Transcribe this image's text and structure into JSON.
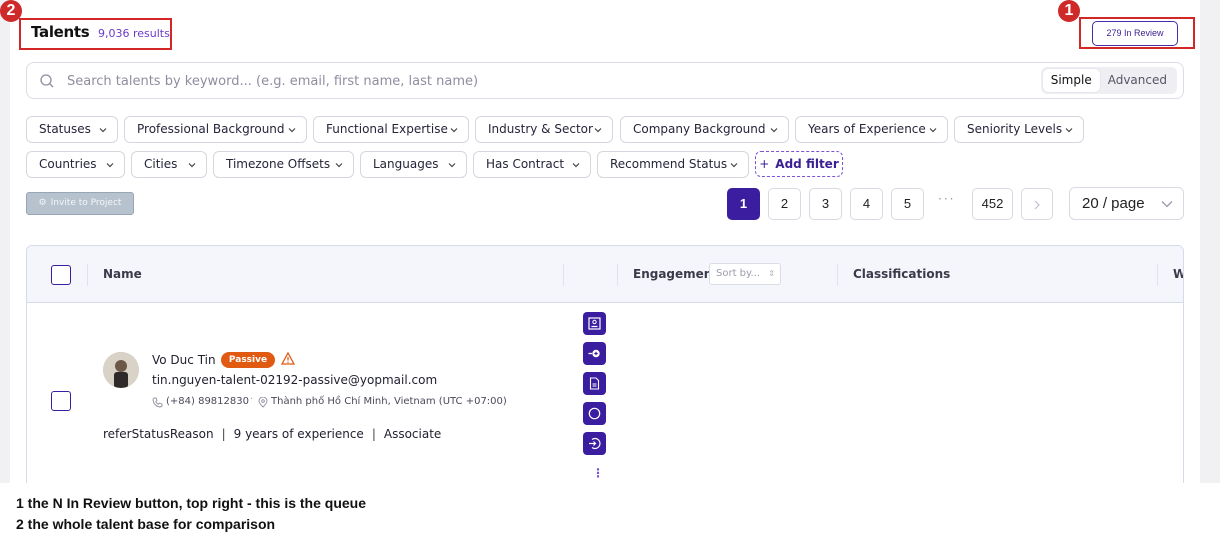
{
  "header": {
    "title": "Talents",
    "results": "9,036 results",
    "review_button": "279  In Review"
  },
  "search": {
    "placeholder": "Search talents by keyword... (e.g. email, first name, last name)",
    "modes": [
      "Simple",
      "Advanced"
    ],
    "active_mode": "Simple"
  },
  "filters": {
    "row1": [
      "Statuses",
      "Professional Background",
      "Functional Expertise",
      "Industry & Sector",
      "Company Background",
      "Years of Experience",
      "Seniority Levels"
    ],
    "row2": [
      "Countries",
      "Cities",
      "Timezone Offsets",
      "Languages",
      "Has Contract",
      "Recommend Status"
    ],
    "add_filter": "Add filter"
  },
  "toolbar": {
    "invite": "Invite to Project"
  },
  "pagination": {
    "pages": [
      "1",
      "2",
      "3",
      "4",
      "5"
    ],
    "ellipsis": "···",
    "last": "452",
    "current": "1",
    "per_page": "20 / page"
  },
  "table": {
    "columns": {
      "name": "Name",
      "engagement": "Engagement",
      "sort_placeholder": "Sort by...",
      "classifications": "Classifications",
      "cut": "W"
    },
    "row": {
      "name": "Vo Duc Tin",
      "status": "Passive",
      "email": "tin.nguyen-talent-02192-passive@yopmail.com",
      "phone": "(+84) 89812830",
      "location": "Thành phố Hồ Chí Minh, Vietnam (UTC +07:00)",
      "refer_reason": "referStatusReason",
      "experience": "9 years of experience",
      "seniority": "Associate"
    }
  },
  "annotations": {
    "n1": "1",
    "n2": "2",
    "caption1": "1  the N In Review button, top right - this is the queue",
    "caption2": "2  the whole talent base for comparison"
  },
  "colors": {
    "primary": "#3b1ea0",
    "accent_text": "#6a3cc9",
    "passive": "#e05a12",
    "callout": "#d32626"
  }
}
